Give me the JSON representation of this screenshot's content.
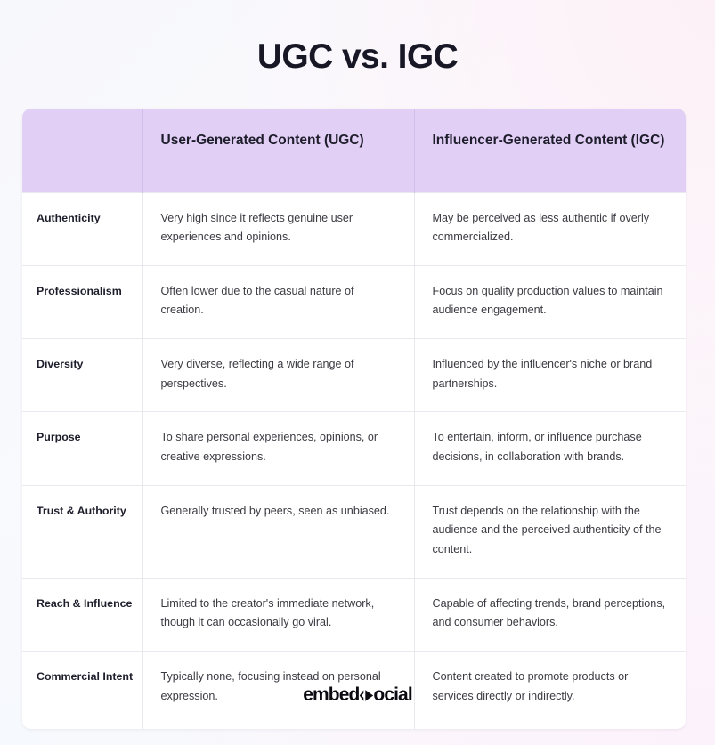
{
  "page": {
    "title": "UGC vs. IGC"
  },
  "table": {
    "headers": {
      "label_column": "",
      "column_ugc": "User-Generated Content (UGC)",
      "column_igc": "Influencer-Generated Content (IGC)"
    },
    "rows": [
      {
        "label": "Authenticity",
        "ugc": "Very high since it reflects genuine user experiences and opinions.",
        "igc": "May be perceived as less authentic if overly commercialized."
      },
      {
        "label": "Professionalism",
        "ugc": "Often lower due to the casual nature of creation.",
        "igc": "Focus on quality production values to maintain audience engagement."
      },
      {
        "label": "Diversity",
        "ugc": "Very diverse, reflecting a wide range of perspectives.",
        "igc": "Influenced by the influencer's niche or brand partnerships."
      },
      {
        "label": "Purpose",
        "ugc": "To share personal experiences, opinions, or creative expressions.",
        "igc": "To entertain, inform, or influence purchase decisions, in collaboration with brands."
      },
      {
        "label": "Trust & Authority",
        "ugc": "Generally trusted by peers, seen as unbiased.",
        "igc": "Trust depends on the relationship with the audience and the perceived authenticity of the content."
      },
      {
        "label": "Reach & Influence",
        "ugc": "Limited to the creator's immediate network, though it can occasionally go viral.",
        "igc": "Capable of affecting trends, brand perceptions, and consumer behaviors."
      },
      {
        "label": "Commercial Intent",
        "ugc": "Typically none, focusing instead on personal expression.",
        "igc": "Content created to promote products or services directly or indirectly."
      }
    ]
  },
  "footer": {
    "logo_text_left": "embed",
    "logo_mark": "chevron-diamond-icon",
    "logo_text_right": "ocial",
    "logo_full": "embedsocial"
  },
  "colors": {
    "header_background": "#e2cff6",
    "title_text": "#171726",
    "body_text": "#3a3a42",
    "label_text": "#1d1d2b",
    "table_background": "#ffffff",
    "row_divider": "#e8e8ee",
    "page_background": "#f7f8fc",
    "logo_text": "#0b0b12"
  }
}
